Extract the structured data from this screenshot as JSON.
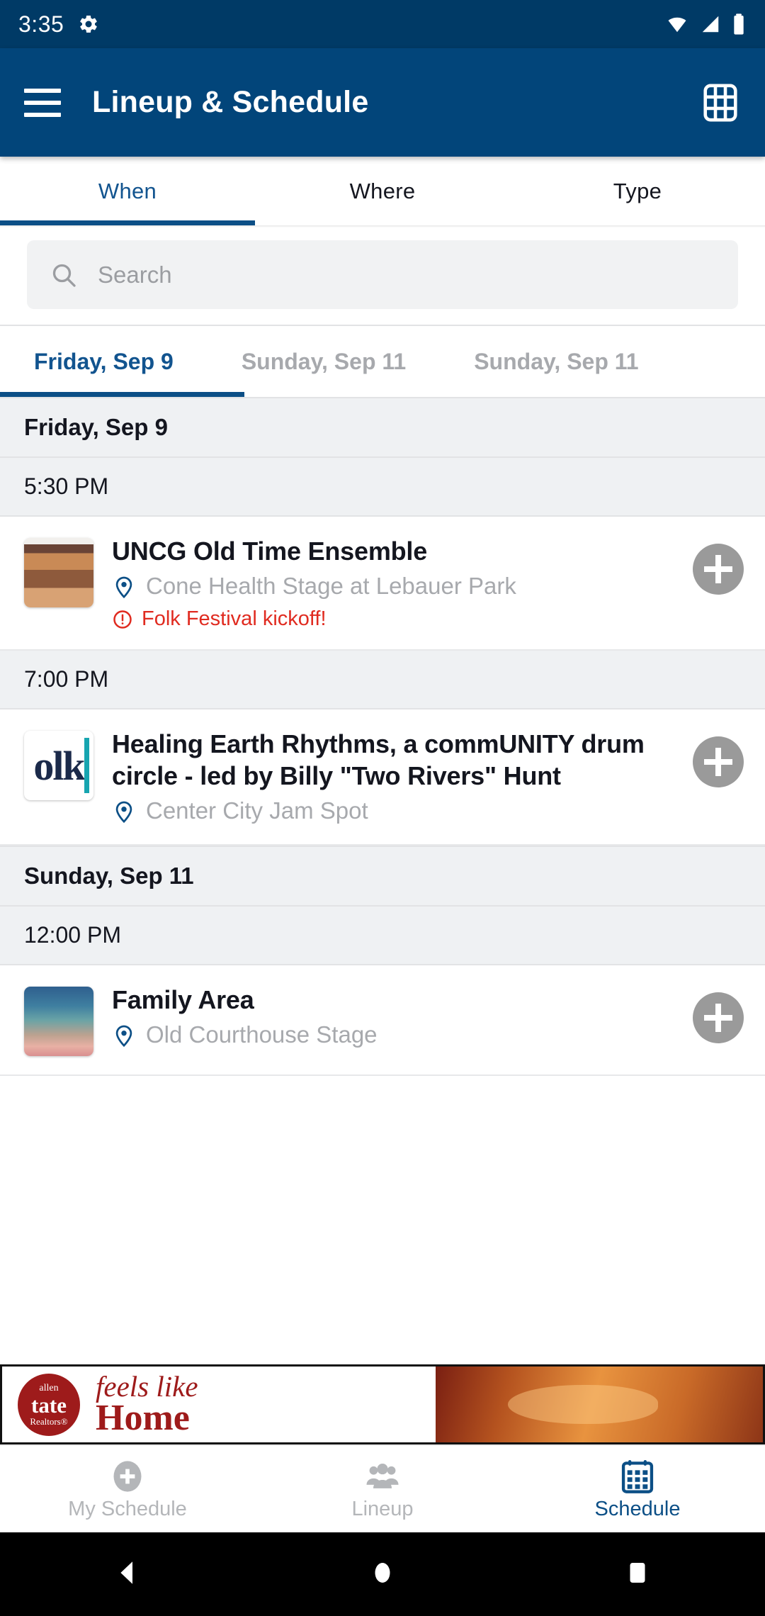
{
  "status_bar": {
    "time": "3:35",
    "icons": [
      "gear-icon",
      "wifi-icon",
      "signal-icon",
      "battery-icon"
    ]
  },
  "app_bar": {
    "title": "Lineup & Schedule",
    "menu_icon": "hamburger-menu-icon",
    "grid_icon": "grid-view-icon",
    "background_color": "#02457a"
  },
  "tabs": {
    "items": [
      {
        "label": "When",
        "active": true
      },
      {
        "label": "Where",
        "active": false
      },
      {
        "label": "Type",
        "active": false
      }
    ],
    "active_color": "#12548f"
  },
  "search": {
    "placeholder": "Search",
    "value": "",
    "icon": "search-icon"
  },
  "date_tabs": {
    "items": [
      {
        "label": "Friday, Sep 9",
        "active": true
      },
      {
        "label": "Sunday, Sep 11",
        "active": false
      },
      {
        "label": "Sunday, Sep 11",
        "active": false
      }
    ]
  },
  "schedule": {
    "sections": [
      {
        "date": "Friday, Sep 9",
        "time_groups": [
          {
            "time": "5:30 PM",
            "events": [
              {
                "title": "UNCG Old Time Ensemble",
                "venue": "Cone Health Stage at Lebauer Park",
                "note": "Folk Festival kickoff!",
                "note_color": "#e02b20",
                "thumb": "crowd-photo-thumbnail",
                "add_button": "add-to-schedule-button"
              }
            ]
          },
          {
            "time": "7:00 PM",
            "events": [
              {
                "title": "Healing Earth Rhythms, a commUNITY drum circle - led by Billy \"Two Rivers\" Hunt",
                "venue": "Center City Jam Spot",
                "note": "",
                "thumb": "folk-logo-thumbnail",
                "add_button": "add-to-schedule-button"
              }
            ]
          }
        ]
      },
      {
        "date": "Sunday, Sep 11",
        "time_groups": [
          {
            "time": "12:00 PM",
            "events": [
              {
                "title": "Family Area",
                "venue": "Old Courthouse Stage",
                "note": "",
                "thumb": "sunset-photo-thumbnail",
                "add_button": "add-to-schedule-button"
              }
            ]
          }
        ]
      }
    ]
  },
  "ad": {
    "seal_line1": "allen",
    "seal_line2": "tate",
    "seal_line3": "Realtors®",
    "tagline_line1": "feels like",
    "tagline_line2": "Home",
    "brand_color": "#9e1b1b"
  },
  "bottom_nav": {
    "items": [
      {
        "label": "My Schedule",
        "icon": "plus-circle-icon",
        "active": false
      },
      {
        "label": "Lineup",
        "icon": "people-group-icon",
        "active": false
      },
      {
        "label": "Schedule",
        "icon": "calendar-icon",
        "active": true
      }
    ],
    "active_color": "#0c4f86"
  },
  "android_nav": {
    "back": "back-triangle-icon",
    "home": "home-circle-icon",
    "recents": "recents-square-icon"
  }
}
